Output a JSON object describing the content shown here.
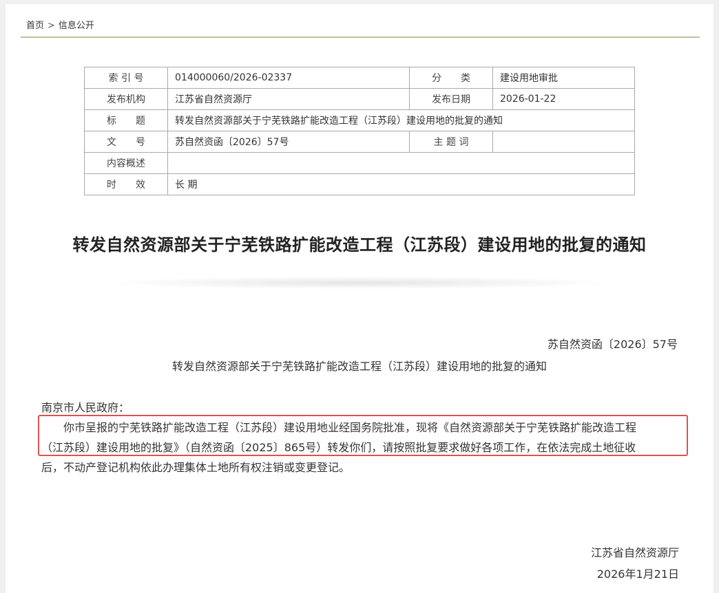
{
  "breadcrumb": {
    "home": "首页",
    "separator": ">",
    "current": "信息公开"
  },
  "meta_table": {
    "index_label": "索 引 号",
    "index_value": "014000060/2026-02337",
    "category_label": "分　　类",
    "category_value": "建设用地审批",
    "publisher_label": "发布机构",
    "publisher_value": "江苏省自然资源厅",
    "date_label": "发布日期",
    "date_value": "2026-01-22",
    "title_label": "标　　题",
    "title_value": "转发自然资源部关于宁芜铁路扩能改造工程（江苏段）建设用地的批复的通知",
    "docno_label": "文　　号",
    "docno_value": "苏自然资函〔2026〕57号",
    "topic_label": "主 题 词",
    "topic_value": "",
    "summary_label": "内容概述",
    "summary_value": "",
    "validity_label": "时　　效",
    "validity_value": "长 期"
  },
  "document": {
    "title": "转发自然资源部关于宁芜铁路扩能改造工程（江苏段）建设用地的批复的通知",
    "doc_number": "苏自然资函〔2026〕57号",
    "subtitle": "转发自然资源部关于宁芜铁路扩能改造工程（江苏段）建设用地的批复的通知",
    "addressee": "南京市人民政府：",
    "body_line1": "你市呈报的宁芜铁路扩能改造工程（江苏段）建设用地业经国务院批准，现将《自然资源部关于宁芜铁路扩能改造工程",
    "body_line2": "（江苏段）建设用地的批复》（自然资函〔2025〕865号）转发你们，请按照批复要求做好各项工作，在依法完成土地征收",
    "body_line3": "后，不动产登记机构依此办理集体土地所有权注销或变更登记。",
    "signature_org": "江苏省自然资源厅",
    "signature_date": "2026年1月21日"
  },
  "colors": {
    "highlight_border": "#d9534f",
    "breadcrumb_rule": "#b9c39a",
    "table_border": "#a9a9a9"
  }
}
